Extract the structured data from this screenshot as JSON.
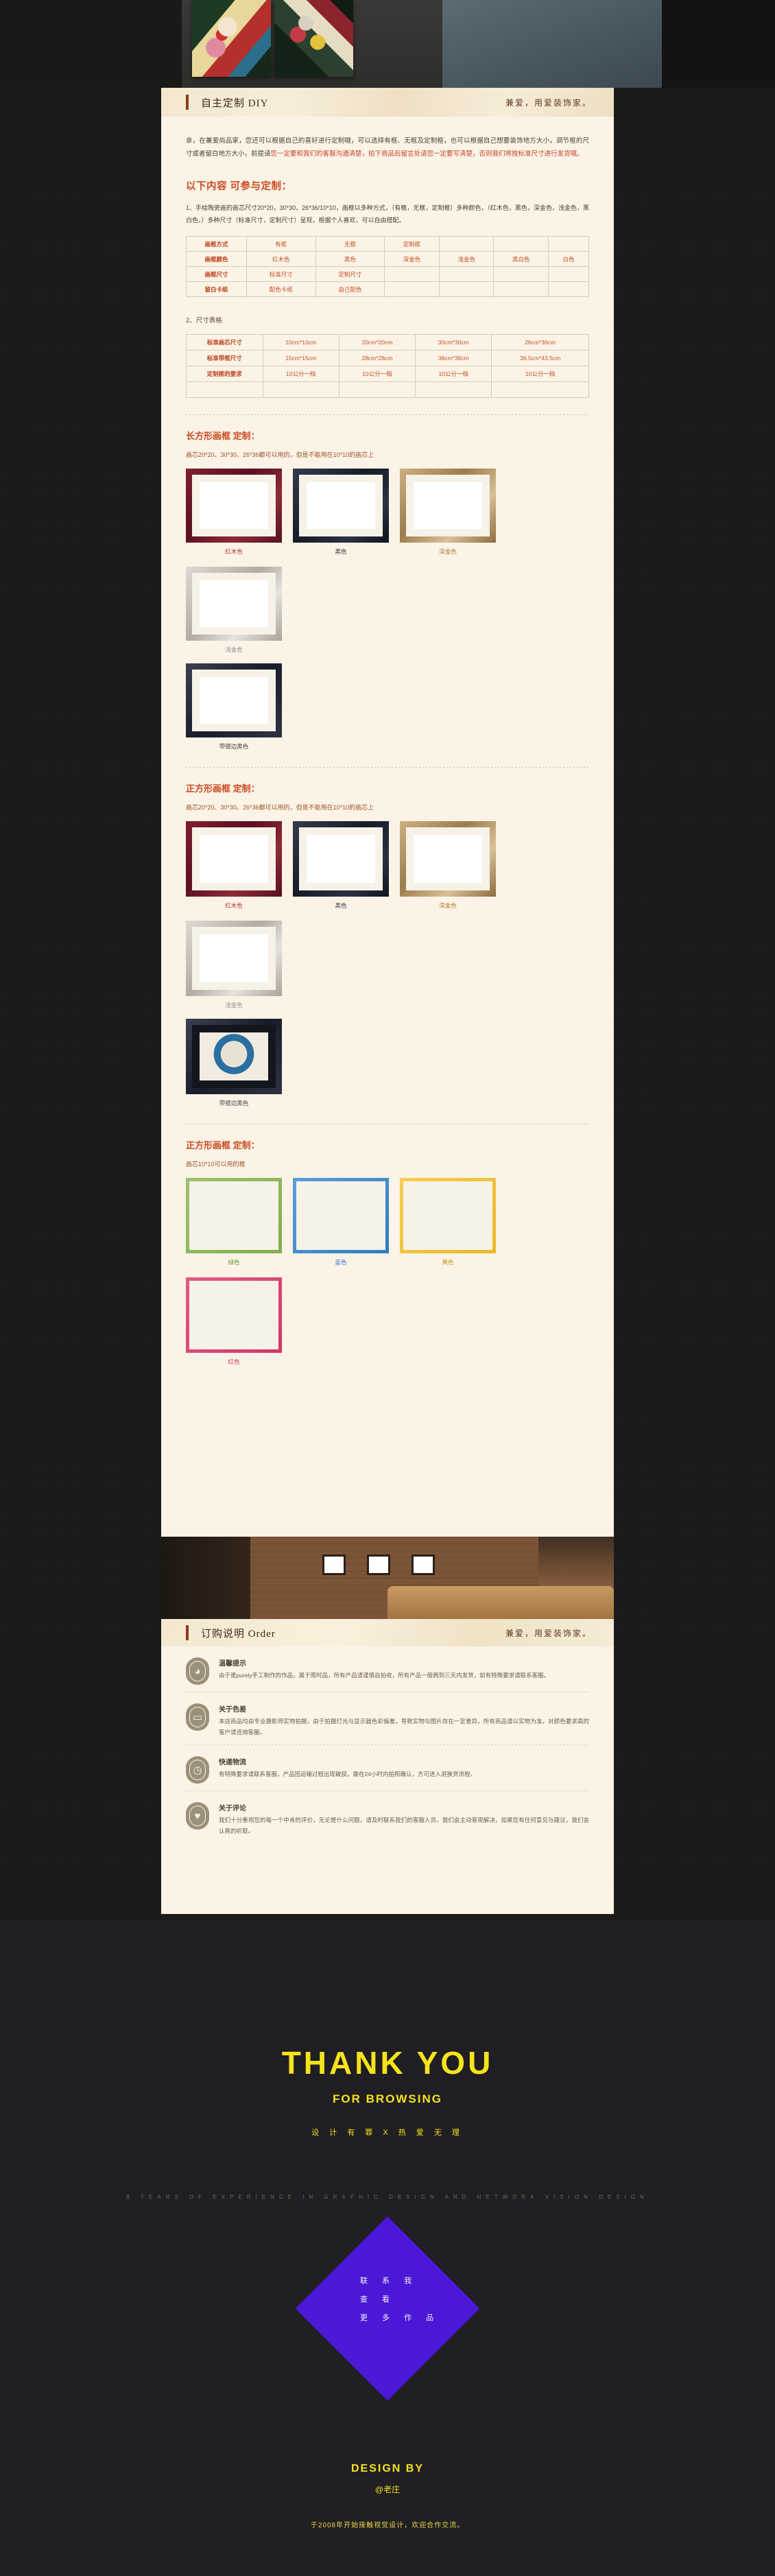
{
  "header": {
    "title": "自主定制 DIY",
    "slogan": "兼爱，用爱装饰家。"
  },
  "intro": {
    "black_part": "亲，在兼爱尚品家，您还可以根据自己的喜好进行定制哦，可以选择有框、无框及定制框，也可以根据自己想要装饰地方大小，调节框的尺寸或者留白地方大小，前提请",
    "red_part": "您一定要和我们的客服沟通清楚，拍下商品后留言处请您一定要写清楚，否则我们将按标准尺寸进行发货哦。"
  },
  "customizable": {
    "heading": "以下内容 可参与定制：",
    "item1": "1、手绘陶瓷画的画芯尺寸20*20，30*30，26*36/10*10，画框以多种方式，（有框，无框，定制框）多种颜色，（红木色，黑色，深金色，浅金色，黑白色，）多种尺寸（标准尺寸，定制尺寸）呈现，根据个人喜欢，可以自由搭配。",
    "item2": "2、尺寸表格"
  },
  "spec_table": {
    "rows": [
      {
        "key": "画框方式",
        "values": [
          "有框",
          "无框",
          "定制框",
          "",
          "",
          ""
        ]
      },
      {
        "key": "画框颜色",
        "values": [
          "红木色",
          "黑色",
          "深金色",
          "浅金色",
          "黑白色",
          "白色"
        ]
      },
      {
        "key": "画框尺寸",
        "values": [
          "标准尺寸",
          "定制尺寸",
          "",
          "",
          "",
          ""
        ]
      },
      {
        "key": "留白卡纸",
        "values": [
          "配色卡纸",
          "自己配色",
          "",
          "",
          "",
          ""
        ]
      }
    ]
  },
  "size_table": {
    "rows": [
      {
        "key": "标准画芯尺寸",
        "values": [
          "10cm*10cm",
          "20cm*20cm",
          "30cm*30cm",
          "26cm*36cm"
        ]
      },
      {
        "key": "标准带框尺寸",
        "values": [
          "15cm*15cm",
          "28cm*28cm",
          "38cm*38cm",
          "36.5cm*43.5cm"
        ]
      },
      {
        "key": "定制框的要求",
        "values": [
          "10公分一档",
          "10公分一档",
          "10公分一档",
          "10公分一档"
        ]
      },
      {
        "key": "",
        "values": [
          "",
          "",
          "",
          ""
        ]
      }
    ]
  },
  "section_rect": {
    "heading": "长方形画框 定制：",
    "note": "画芯20*20、30*30、26*36都可以用的，但是不能用在10*10的画芯上",
    "frames": [
      {
        "label": "红木色",
        "color_class": "c-red",
        "label_class": "lbl-red"
      },
      {
        "label": "黑色",
        "color_class": "c-black",
        "label_class": "lbl-black"
      },
      {
        "label": "深金色",
        "color_class": "c-dgold",
        "label_class": "lbl-dgold"
      },
      {
        "label": "浅金色",
        "color_class": "c-lgold",
        "label_class": "lbl-lgold"
      }
    ],
    "frames_row2": [
      {
        "label": "带银边黑色",
        "color_class": "c-silbk",
        "label_class": "lbl-silbk"
      }
    ]
  },
  "section_square": {
    "heading": "正方形画框 定制：",
    "note": "画芯20*20、30*30、26*36都可以用的，但是不能用在10*10的画芯上",
    "frames": [
      {
        "label": "红木色",
        "color_class": "c-red",
        "label_class": "lbl-red"
      },
      {
        "label": "黑色",
        "color_class": "c-black",
        "label_class": "lbl-black"
      },
      {
        "label": "深金色",
        "color_class": "c-dgold",
        "label_class": "lbl-dgold"
      },
      {
        "label": "浅金色",
        "color_class": "c-lgold",
        "label_class": "lbl-lgold"
      }
    ],
    "frames_row2": [
      {
        "label": "带银边黑色",
        "color_class": "c-silbk",
        "label_class": "lbl-silbk"
      }
    ]
  },
  "section_small": {
    "heading": "正方形画框 定制：",
    "note": "画芯10*10可以用的框",
    "frames": [
      {
        "label": "绿色",
        "color_class": "c-green",
        "label_class": "lbl-green"
      },
      {
        "label": "蓝色",
        "color_class": "c-blue",
        "label_class": "lbl-blue"
      },
      {
        "label": "黄色",
        "color_class": "c-yellow",
        "label_class": "lbl-yellow"
      },
      {
        "label": "红色",
        "color_class": "c-pink",
        "label_class": "lbl-pink"
      }
    ]
  },
  "order": {
    "title": "订购说明 Order",
    "slogan": "兼爱，用爱装饰家。",
    "items": [
      {
        "icon": "speaker-icon",
        "glyph": "◕",
        "title": "温馨提示",
        "desc": "由于是purely手工制作的作品，属于限时品，所有产品请谨慎自拍收，所有产品一般两到三天内发货，如有特殊要求请联系客服。"
      },
      {
        "icon": "monitor-icon",
        "glyph": "▭",
        "title": "关于色差",
        "desc": "本店商品均由专业摄影师实物拍摄，由于拍摄灯光与显示器色彩偏差，导致实物与图片存在一定差异，所有商品请以实物为准，对颜色要求高的客户请咨询客服。"
      },
      {
        "icon": "clock-icon",
        "glyph": "◷",
        "title": "快递物流",
        "desc": "有特殊要求请联系客服，产品因运输过程出现破损，需在24小时内拍照确认，方可进入退换货流程。"
      },
      {
        "icon": "heart-icon",
        "glyph": "♥",
        "title": "关于评论",
        "desc": "我们十分重视您的每一个中肯的评价，无论是什么问题，请及时联系我们的客服人员，我们会主动客观解决，如果您有任何意见与建议，我们会认真的听取。"
      }
    ]
  },
  "footer": {
    "thanks": "THANK YOU",
    "browsing": "FOR BROWSING",
    "tagline": "设 计 有 罪  X  热 爱 无 理",
    "experience": "8 YEARS OF EXPERIENCE IN GRAPHIC DESIGN AND NETWORK VISION DESIGN",
    "contact_lines": [
      "联  系  我",
      "查     看",
      "更  多  作  品"
    ],
    "design_by": "DESIGN BY",
    "handle": "@老庄",
    "since": "于2008年开始接触视觉设计，欢迎合作交流。"
  }
}
